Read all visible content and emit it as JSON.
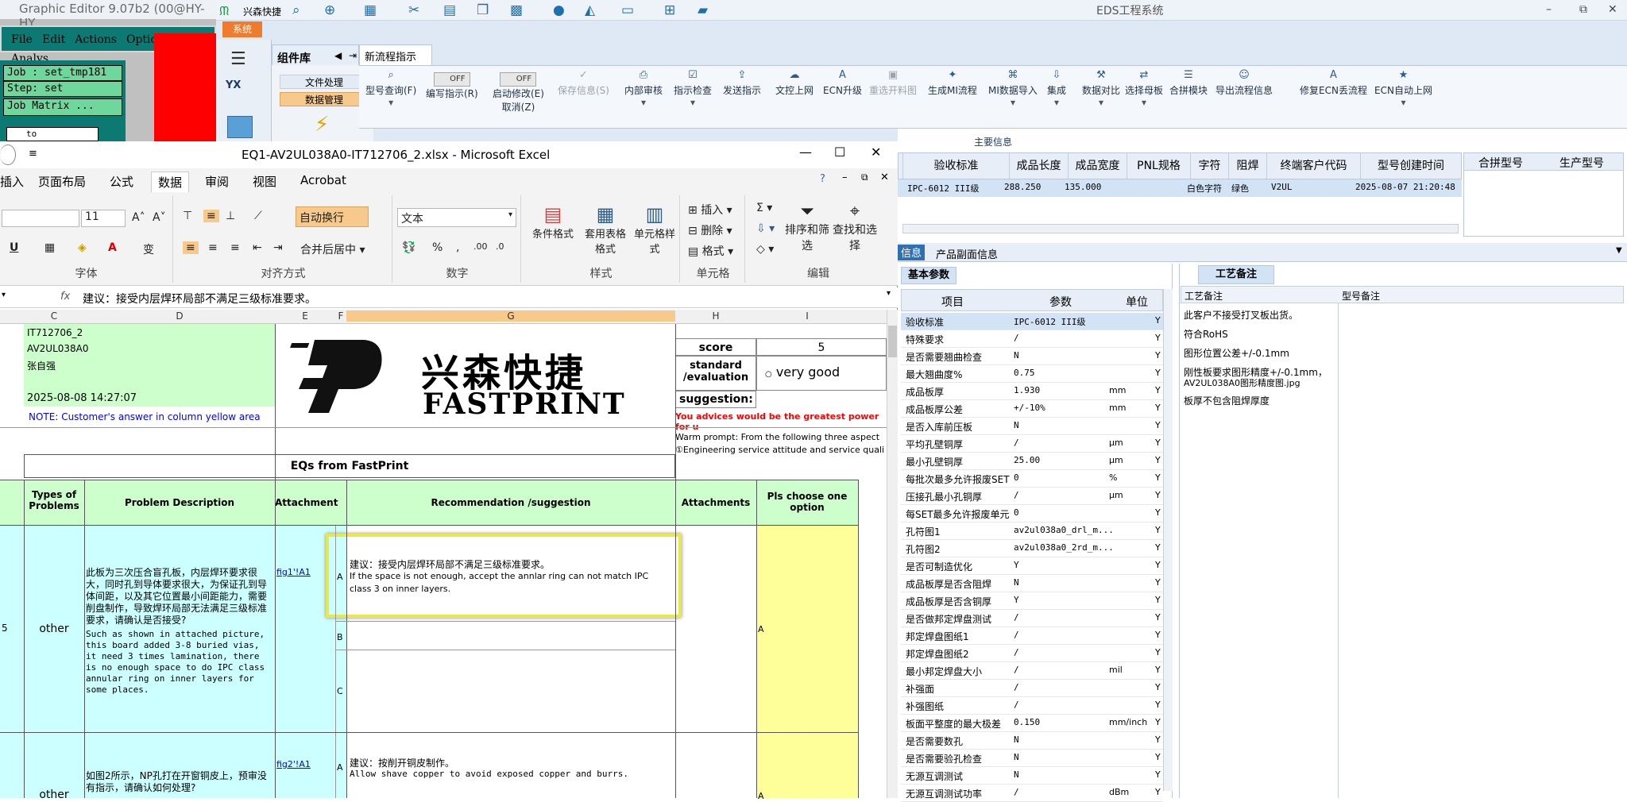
{
  "graphic_editor": {
    "title": "Graphic Editor 9.07b2 (00@HY-HY",
    "menu": [
      "File",
      "Edit",
      "Actions",
      "Options",
      "Analys"
    ],
    "job": "Job : set_tmp181",
    "step": "Step: set",
    "job_matrix": "Job Matrix ...",
    "to_field": "to"
  },
  "eds": {
    "app_name": "兴森快捷",
    "title": "EDS工程系统",
    "system_tab": "系统",
    "components_label": "组件库",
    "active_tab": "新流程指示",
    "side_items": [
      "文件处理",
      "数据管理"
    ],
    "toggle_off": "OFF",
    "ribbon": [
      "型号查询(F)",
      "编写指示(R)",
      "启动修改(E)",
      "保存信息(S)",
      "内部审核",
      "指示检查",
      "发送指示",
      "文控上网",
      "ECN升级",
      "重选开料图",
      "生成MI流程",
      "MI数据导入",
      "集成",
      "数据对比",
      "选择母板",
      "合拼模块",
      "导出流程信息",
      "修复ECN丢流程",
      "ECN自动上网"
    ],
    "cancel_label": "取消(Z)",
    "main_info": "主要信息",
    "top_headers": [
      "验收标准",
      "成品长度",
      "成品宽度",
      "PNL规格",
      "字符",
      "阻焊",
      "终端客户代码",
      "型号创建时间",
      "合拼型号",
      "生产型号"
    ],
    "top_row": [
      "IPC-6012 III级",
      "288.250",
      "135.000",
      "",
      "白色字符",
      "绿色",
      "V2UL",
      "2025-08-07 21:20:48"
    ],
    "bottom_tabs": [
      "信息",
      "产品副面信息"
    ],
    "basic_params_tab": "基本参数",
    "params_headers": [
      "项目",
      "参数",
      "单位"
    ],
    "params": [
      {
        "n": "验收标准",
        "v": "IPC-6012 III级",
        "u": "",
        "y": "Y"
      },
      {
        "n": "特殊要求",
        "v": "/",
        "u": "",
        "y": "Y"
      },
      {
        "n": "是否需要翘曲检查",
        "v": "N",
        "u": "",
        "y": "Y"
      },
      {
        "n": "最大翘曲度%",
        "v": "0.75",
        "u": "",
        "y": "Y"
      },
      {
        "n": "成品板厚",
        "v": "1.930",
        "u": "mm",
        "y": "Y"
      },
      {
        "n": "成品板厚公差",
        "v": "+/-10%",
        "u": "mm",
        "y": "Y"
      },
      {
        "n": "是否入库前压板",
        "v": "N",
        "u": "",
        "y": "Y"
      },
      {
        "n": "平均孔壁铜厚",
        "v": "/",
        "u": "μm",
        "y": "Y"
      },
      {
        "n": "最小孔壁铜厚",
        "v": "25.00",
        "u": "μm",
        "y": "Y"
      },
      {
        "n": "每批次最多允许报废SET",
        "v": "0",
        "u": "%",
        "y": "Y"
      },
      {
        "n": "压接孔最小孔铜厚",
        "v": "/",
        "u": "μm",
        "y": "Y"
      },
      {
        "n": "每SET最多允许报废单元",
        "v": "0",
        "u": "",
        "y": "Y"
      },
      {
        "n": "孔符图1",
        "v": "av2ul038a0_drl_m...",
        "u": "",
        "y": "Y"
      },
      {
        "n": "孔符图2",
        "v": "av2ul038a0_2rd_m...",
        "u": "",
        "y": "Y"
      },
      {
        "n": "是否可制造优化",
        "v": "Y",
        "u": "",
        "y": "Y"
      },
      {
        "n": "成品板厚是否含阻焊",
        "v": "N",
        "u": "",
        "y": "Y"
      },
      {
        "n": "成品板厚是否含铜厚",
        "v": "Y",
        "u": "",
        "y": "Y"
      },
      {
        "n": "是否做邦定焊盘测试",
        "v": "/",
        "u": "",
        "y": "Y"
      },
      {
        "n": "邦定焊盘图纸1",
        "v": "/",
        "u": "",
        "y": "Y"
      },
      {
        "n": "邦定焊盘图纸2",
        "v": "/",
        "u": "",
        "y": "Y"
      },
      {
        "n": "最小邦定焊盘大小",
        "v": "/",
        "u": "mil",
        "y": "Y"
      },
      {
        "n": "补强面",
        "v": "/",
        "u": "",
        "y": "Y"
      },
      {
        "n": "补强图纸",
        "v": "/",
        "u": "",
        "y": "Y"
      },
      {
        "n": "板面平整度的最大极差",
        "v": "0.150",
        "u": "mm/inch",
        "y": "Y"
      },
      {
        "n": "是否需要数孔",
        "v": "N",
        "u": "",
        "y": "Y"
      },
      {
        "n": "是否需要验孔检查",
        "v": "N",
        "u": "",
        "y": "Y"
      },
      {
        "n": "无源互调测试",
        "v": "N",
        "u": "",
        "y": "Y"
      },
      {
        "n": "无源互调测试功率",
        "v": "/",
        "u": "dBm",
        "y": "Y"
      }
    ],
    "craft_tab": "工艺备注",
    "craft_headers": [
      "工艺备注",
      "型号备注"
    ],
    "craft_notes": [
      "此客户不接受打叉板出货。",
      "符合RoHS",
      "图形位置公差+/-0.1mm",
      "刚性板要求图形精度+/-0.1mm，",
      "AV2UL038A0图形精度图.jpg",
      "板厚不包含阻焊厚度"
    ]
  },
  "excel": {
    "title": "EQ1-AV2UL038A0-IT712706_2.xlsx - Microsoft Excel",
    "tabs": [
      "插入",
      "页面布局",
      "公式",
      "数据",
      "审阅",
      "视图",
      "Acrobat"
    ],
    "groups": [
      "字体",
      "对齐方式",
      "数字",
      "样式",
      "单元格",
      "编辑"
    ],
    "font_size": "11",
    "wrap_text": "自动换行",
    "merge_center": "合并后居中",
    "number_format": "文本",
    "cond_format": "条件格式",
    "table_format": "套用表格格式",
    "cell_style": "单元格样式",
    "insert": "插入",
    "delete": "删除",
    "format": "格式",
    "sort_filter": "排序和筛选",
    "find_select": "查找和选择",
    "formula": "建议：接受内层焊环局部不满足三级标准要求。",
    "fx": "fx",
    "columns": [
      "C",
      "D",
      "E",
      "F",
      "G",
      "H",
      "I"
    ],
    "info": [
      "IT712706_2",
      "AV2UL038A0",
      "张自强",
      "",
      "2025-08-08 14:27:07"
    ],
    "note": "NOTE: Customer's  answer in column yellow area",
    "logo_cn": "兴森快捷",
    "logo_en": "FASTPRINT",
    "score_label": "score",
    "score_value": "5",
    "standard_label": "standard /evaluation",
    "very_good": "very good",
    "suggestion_label": "suggestion:",
    "advice": "You advices would be the greatest power for u",
    "warm1": "Warm prompt:  From the following three aspect",
    "warm2": "①Engineering service attitude and service quali",
    "eqs_title": "EQs from FastPrint",
    "headers": [
      "Types of Problems",
      "Problem Description",
      "Attachment",
      "Recommendation /suggestion",
      "Attachments",
      "Pls choose one option"
    ],
    "row1_type": "other",
    "row1_desc_cn": "此板为三次压合盲孔板，内层焊环要求很大，同时孔到导体要求很大，为保证孔到导体间距，以及其它位置最小间距能力，需要削盘制作，导致焊环局部无法满足三级标准要求，请确认是否接受?",
    "row1_desc_en": "Such as shown in attached picture, this board added 3-8 buried vias, it need 3 times lamination, there is no enough space to do IPC class annular ring on inner layers for some places.",
    "row1_attach": "fig1'!A1",
    "opt_a": "A",
    "opt_b": "B",
    "opt_c": "C",
    "row1_rec_cn": "建议：接受内层焊环局部不满足三级标准要求。",
    "row1_rec_en": "If the space is not enough, accept the annlar ring can not match IPC class 3 on inner layers.",
    "row1_choice": "A",
    "row2_type": "other",
    "row2_desc_cn": "如图2所示，NP孔打在开窗铜皮上，预审没有指示，请确认如何处理?",
    "row2_attach": "fig2'!A1",
    "row2_rec_cn": "建议：按削开铜皮制作。",
    "row2_rec_en": "Allow shave copper to avoid exposed copper and burrs.",
    "row2_choice": "A",
    "row_num": "5",
    "colors": {
      "green": "#ccffcc",
      "cyan": "#ccffff",
      "yellow": "#ffff99",
      "red": "#ff0000",
      "blue": "#0000ff",
      "highlight": "#e8e84a"
    }
  }
}
